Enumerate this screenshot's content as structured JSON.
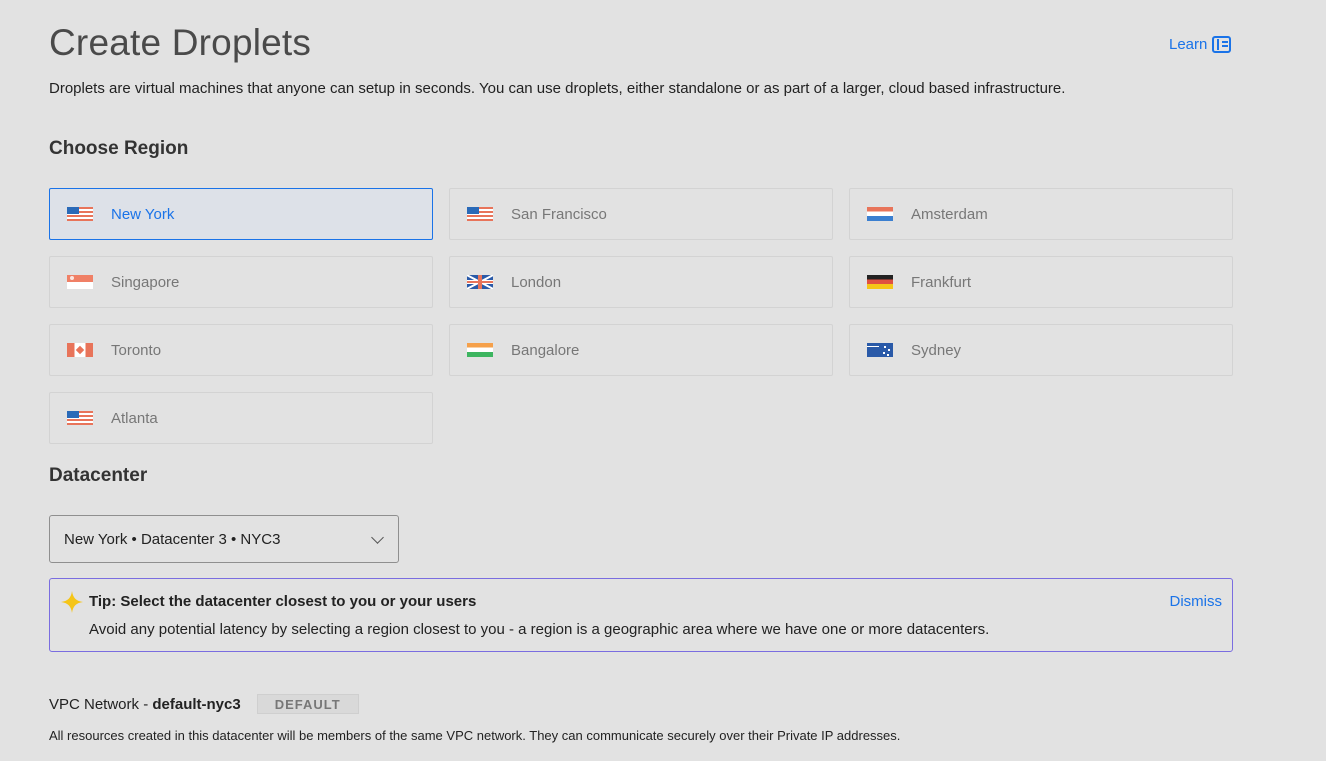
{
  "header": {
    "title": "Create Droplets",
    "learn_label": "Learn",
    "subtitle": "Droplets are virtual machines that anyone can setup in seconds. You can use droplets, either standalone or as part of a larger, cloud based infrastructure."
  },
  "region_section": {
    "heading": "Choose Region",
    "selected": "New York",
    "regions": [
      {
        "label": "New York",
        "flag": "us-flag-icon",
        "selected": true
      },
      {
        "label": "San Francisco",
        "flag": "us-flag-icon",
        "selected": false
      },
      {
        "label": "Amsterdam",
        "flag": "nl-flag-icon",
        "selected": false
      },
      {
        "label": "Singapore",
        "flag": "sg-flag-icon",
        "selected": false
      },
      {
        "label": "London",
        "flag": "uk-flag-icon",
        "selected": false
      },
      {
        "label": "Frankfurt",
        "flag": "de-flag-icon",
        "selected": false
      },
      {
        "label": "Toronto",
        "flag": "ca-flag-icon",
        "selected": false
      },
      {
        "label": "Bangalore",
        "flag": "in-flag-icon",
        "selected": false
      },
      {
        "label": "Sydney",
        "flag": "au-flag-icon",
        "selected": false
      },
      {
        "label": "Atlanta",
        "flag": "us-flag-icon",
        "selected": false
      }
    ]
  },
  "datacenter": {
    "heading": "Datacenter",
    "selected_value": "New York • Datacenter 3 • NYC3"
  },
  "tip": {
    "title": "Tip: Select the datacenter closest to you or your users",
    "body": "Avoid any potential latency by selecting a region closest to you - a region is a geographic area where we have one or more datacenters.",
    "dismiss_label": "Dismiss"
  },
  "vpc": {
    "label": "VPC Network - ",
    "name": "default-nyc3",
    "badge": "DEFAULT",
    "description": "All resources created in this datacenter will be members of the same VPC network. They can communicate securely over their Private IP addresses."
  },
  "colors": {
    "accent": "#1a73e8",
    "tip_border": "#7a6de0",
    "background": "#e2e2e2"
  }
}
